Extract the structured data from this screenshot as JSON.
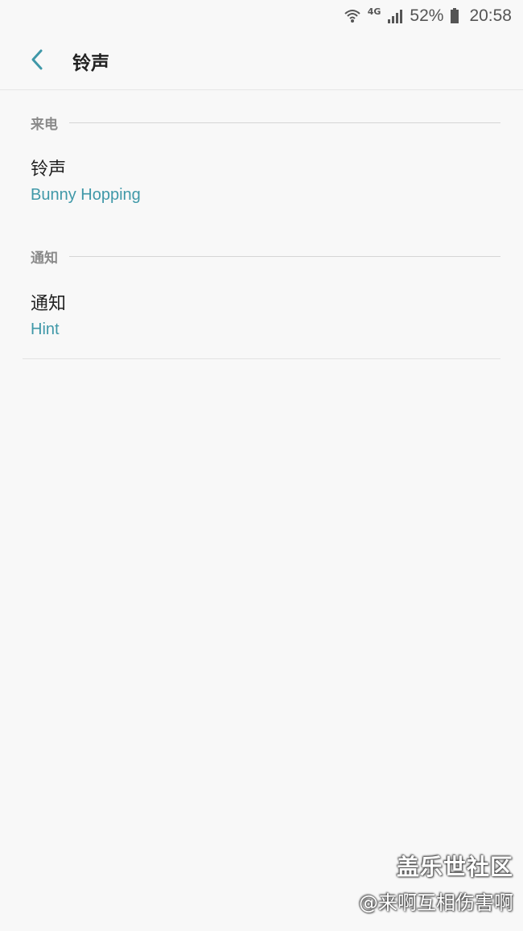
{
  "status_bar": {
    "wifi_icon": "wifi-icon",
    "network_type": "4G",
    "signal_icon": "signal-bars-icon",
    "battery_percent": "52%",
    "battery_icon": "battery-icon",
    "time": "20:58"
  },
  "app_bar": {
    "back_icon": "chevron-left-icon",
    "title": "铃声"
  },
  "sections": {
    "incoming": {
      "header": "来电",
      "item_title": "铃声",
      "item_value": "Bunny Hopping"
    },
    "notification": {
      "header": "通知",
      "item_title": "通知",
      "item_value": "Hint"
    }
  },
  "watermark": {
    "line1": "盖乐世社区",
    "line2": "@来啊互相伤害啊"
  },
  "colors": {
    "accent": "#3f98a8",
    "background": "#f8f8f8",
    "section_header": "#8a8a8a"
  }
}
